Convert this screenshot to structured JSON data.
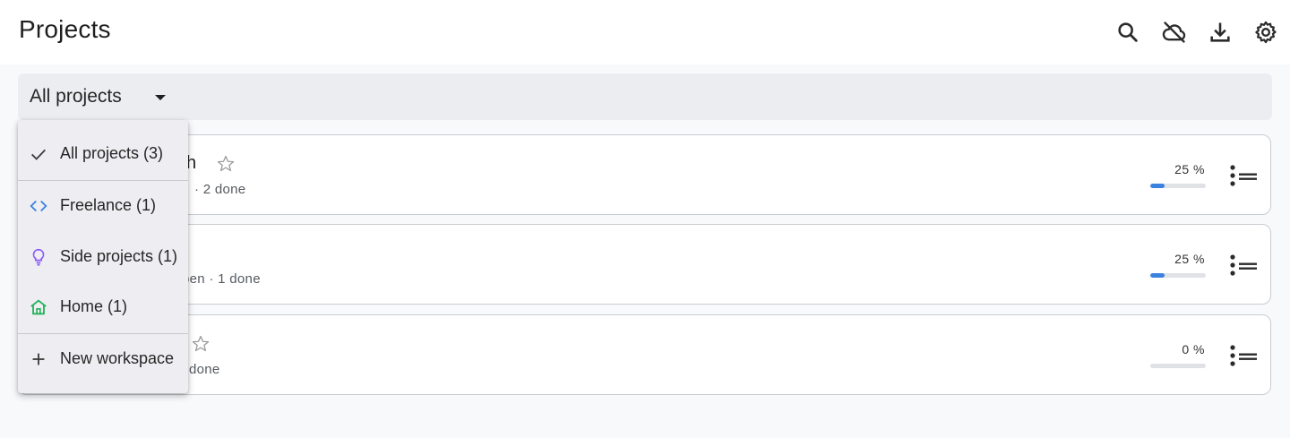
{
  "header": {
    "title": "Projects",
    "icons": [
      "search-icon",
      "cloud-off-icon",
      "download-icon",
      "settings-icon"
    ]
  },
  "filter": {
    "selected": "All projects"
  },
  "menu": {
    "items": [
      {
        "label": "All projects (3)",
        "icon": "check-icon",
        "color": "#3c3c3c",
        "selected": true
      },
      {
        "label": "Freelance (1)",
        "icon": "code-icon",
        "color": "#3b82e0"
      },
      {
        "label": "Side projects (1)",
        "icon": "lightbulb-icon",
        "color": "#8b5cf6"
      },
      {
        "label": "Home (1)",
        "icon": "home-icon",
        "color": "#22b35a"
      },
      {
        "label": "New workspace",
        "icon": "plus-icon",
        "color": "#3c3c3c"
      }
    ]
  },
  "projects": [
    {
      "name_visible": "ch",
      "meta_visible": "· 2 done",
      "percent_label": "25 %",
      "progress": 0.25,
      "starred": false
    },
    {
      "name_visible": "",
      "meta_visible": "pen · 1 done",
      "percent_label": "25 %",
      "progress": 0.25,
      "starred": null
    },
    {
      "name_visible": "",
      "meta_visible": "done",
      "percent_label": "0 %",
      "progress": 0.0,
      "starred": false
    }
  ],
  "colors": {
    "accent": "#3b82e0",
    "progress_track": "#e0e2e6",
    "card_border": "#c9ccd1"
  }
}
